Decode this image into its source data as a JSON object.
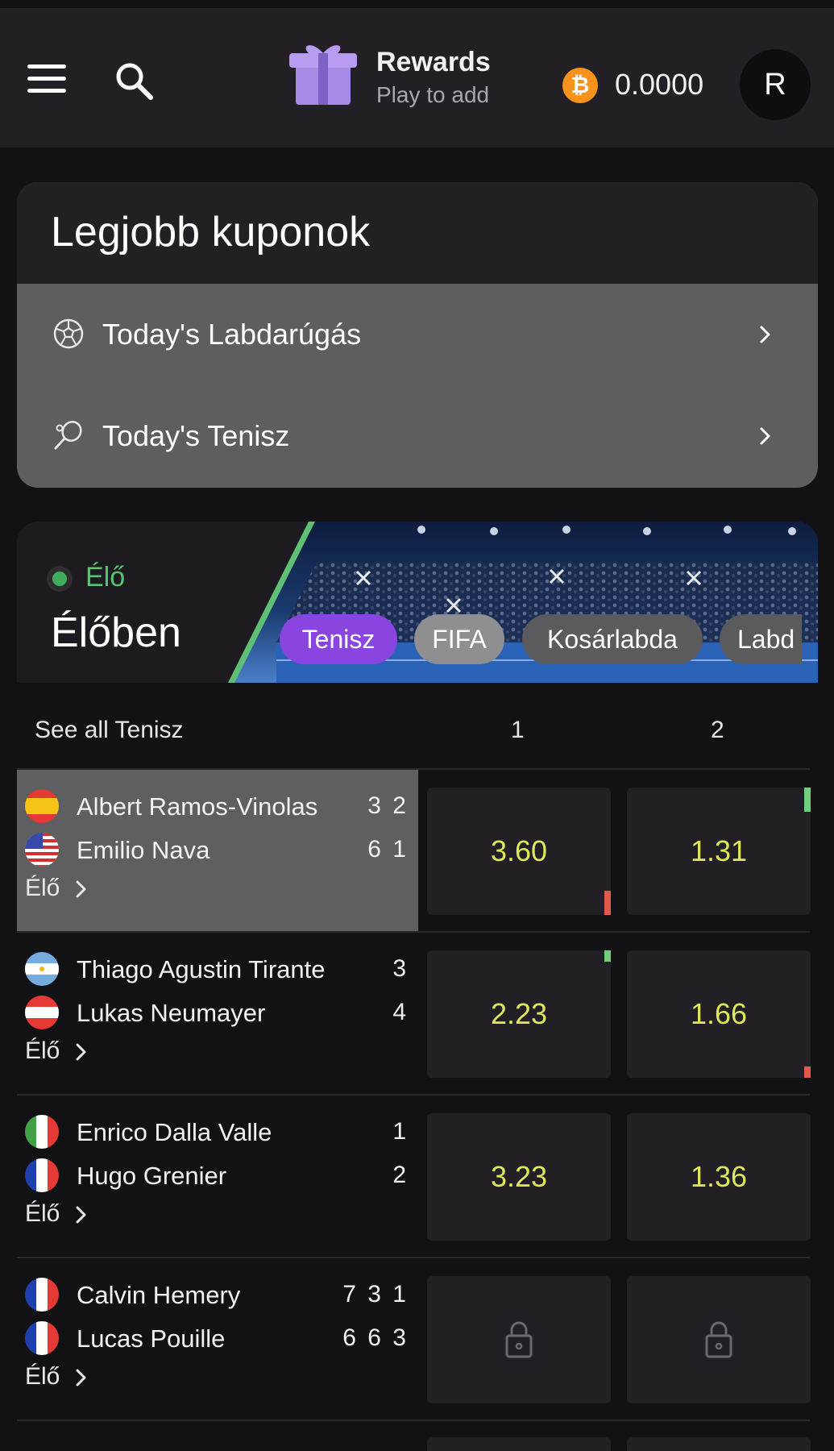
{
  "header": {
    "rewards_title": "Rewards",
    "rewards_subtitle": "Play to add",
    "balance": "0.0000",
    "currency_symbol": "₿",
    "avatar_initial": "R"
  },
  "coupons": {
    "title": "Legjobb kuponok",
    "items": [
      {
        "label": "Today's Labdarúgás",
        "icon": "soccer-ball-icon"
      },
      {
        "label": "Today's Tenisz",
        "icon": "tennis-racket-icon"
      }
    ]
  },
  "live": {
    "badge": "Élő",
    "title": "Élőben",
    "chips": [
      "Tenisz",
      "FIFA",
      "Kosárlabda",
      "Labd"
    ],
    "active_chip": "Tenisz",
    "see_all": "See all Tenisz",
    "col1": "1",
    "col2": "2",
    "live_label": "Élő"
  },
  "matches": [
    {
      "p1": "Albert Ramos-Vinolas",
      "p1_flag": "es",
      "p1_score": "3 2",
      "p2": "Emilio Nava",
      "p2_flag": "us",
      "p2_score": "6 1",
      "odd1": "3.60",
      "odd2": "1.31",
      "odd1_trend": "down",
      "odd2_trend": "up",
      "highlighted": true
    },
    {
      "p1": "Thiago Agustin Tirante",
      "p1_flag": "ar",
      "p1_score": "3",
      "p2": "Lukas Neumayer",
      "p2_flag": "at",
      "p2_score": "4",
      "odd1": "2.23",
      "odd2": "1.66",
      "odd1_trend": "up",
      "odd2_trend": "down"
    },
    {
      "p1": "Enrico Dalla Valle",
      "p1_flag": "it",
      "p1_score": "1",
      "p2": "Hugo Grenier",
      "p2_flag": "fr",
      "p2_score": "2",
      "odd1": "3.23",
      "odd2": "1.36"
    },
    {
      "p1": "Calvin Hemery",
      "p1_flag": "fr",
      "p1_score": "7 3 1",
      "p2": "Lucas Pouille",
      "p2_flag": "fr",
      "p2_score": "6 6 3",
      "odd1": "",
      "odd2": "",
      "locked": true
    }
  ]
}
